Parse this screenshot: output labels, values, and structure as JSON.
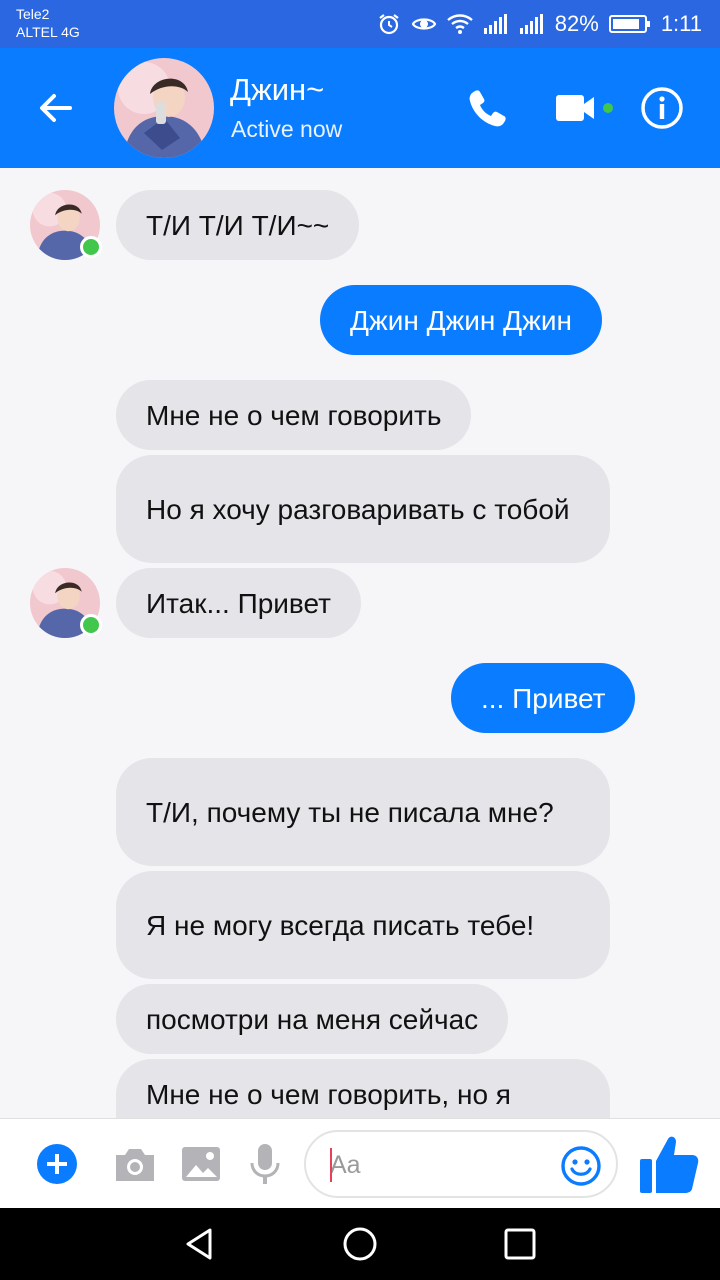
{
  "status_bar": {
    "carrier_line1": "Tele2",
    "carrier_line2": "ALTEL 4G",
    "battery": "82%",
    "time": "1:11"
  },
  "header": {
    "name": "Джин~",
    "status": "Active now",
    "icons": [
      "back-arrow-icon",
      "phone-icon",
      "video-camera-icon",
      "info-icon"
    ]
  },
  "messages": [
    {
      "side": "in",
      "text": "Т/И Т/И Т/И~~"
    },
    {
      "side": "out",
      "text": "Джин Джин Джин"
    },
    {
      "side": "in",
      "text": "Мне не о чем говорить"
    },
    {
      "side": "in",
      "text": "Но я хочу разговаривать с тобой"
    },
    {
      "side": "in",
      "text": "Итак... Привет"
    },
    {
      "side": "out",
      "text": "... Привет"
    },
    {
      "side": "in",
      "text": "Т/И, почему ты не писала мне?"
    },
    {
      "side": "in",
      "text": "Я не могу всегда писать тебе!"
    },
    {
      "side": "in",
      "text": "посмотри на меня сейчас"
    },
    {
      "side": "in",
      "text": "Мне не о чем говорить, но я"
    }
  ],
  "composer": {
    "placeholder": "Aa",
    "icons": [
      "plus-icon",
      "camera-icon",
      "image-icon",
      "microphone-icon",
      "emoji-icon",
      "thumbs-up-icon"
    ]
  },
  "colors": {
    "accent": "#0a7cff",
    "incoming_bubble": "#e4e4e9",
    "online": "#42c74c"
  }
}
